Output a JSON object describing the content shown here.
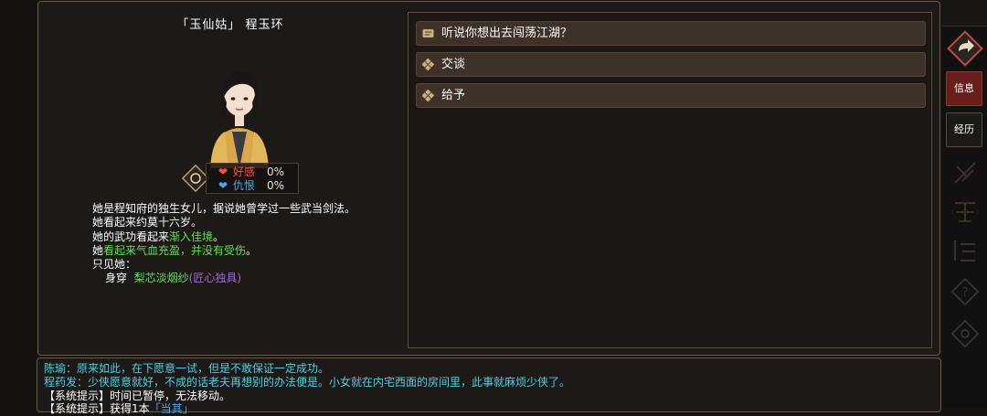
{
  "npc": {
    "title": "「玉仙姑」  程玉环"
  },
  "relation": {
    "favor_label": "好感",
    "favor_value": "0%",
    "hatred_label": "仇恨",
    "hatred_value": "0%"
  },
  "description": {
    "line1": "她是程知府的独生女儿，据说她曾学过一些武当剑法。",
    "line2": "她看起来约莫十六岁。",
    "line3_prefix": "她的武功看起来",
    "line3_level": "渐入佳境",
    "line3_suffix": "。",
    "line4_prefix": "她",
    "line4_status": "看起来气血充盈，并没有受伤",
    "line4_suffix": "。",
    "line5": "只见她：",
    "wear_label": "身穿",
    "wear_item": "梨芯淡烟纱",
    "wear_quality_open": "(",
    "wear_quality": "匠心独具",
    "wear_quality_close": ")"
  },
  "options": [
    {
      "label": "听说你想出去闯荡江湖？",
      "icon": "quest-scroll-icon"
    },
    {
      "label": "交谈",
      "icon": "diamond-icon"
    },
    {
      "label": "给予",
      "icon": "diamond-icon"
    }
  ],
  "sidebar": {
    "info_label": "信息",
    "experience_label": "经历"
  },
  "log": {
    "line1": "陈瑜：原来如此，在下愿意一试，但是不敢保证一定成功。",
    "line2": "程药发：少侠愿意就好，不成的话老夫再想别的办法便是。小女就在内宅西面的房间里，此事就麻烦少侠了。",
    "line3": "【系统提示】时间已暂停，无法移动。",
    "line4_prefix": "【系统提示】获得1本",
    "line4_link": "「当其」"
  },
  "colors": {
    "favor": "#ff4e3c",
    "hatred": "#4aa8e8",
    "highlight_green": "#5fe04e",
    "quality_purple": "#9d6bd6",
    "log_cyan": "#4ad0e6",
    "active_tab": "#6a1e1a"
  }
}
